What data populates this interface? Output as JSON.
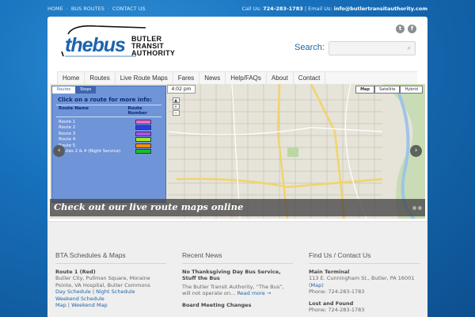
{
  "topbar": {
    "nav": [
      "HOME",
      "BUS ROUTES",
      "CONTACT US"
    ],
    "call_label": "Call Us:",
    "phone": "724-283-1783",
    "email_label": "Email Us:",
    "email": "info@butlertransitauthority.com"
  },
  "header": {
    "logo_word": "thebus",
    "logo_lines": [
      "BUTLER",
      "TRANSIT",
      "AUTHORITY"
    ],
    "search_label": "Search:",
    "search_placeholder": "",
    "social": [
      "t",
      "f"
    ]
  },
  "nav": [
    "Home",
    "Routes",
    "Live Route Maps",
    "Fares",
    "News",
    "Help/FAQs",
    "About",
    "Contact"
  ],
  "slider": {
    "tabs": [
      "Routes",
      "Stops"
    ],
    "title": "Click on a route for more info:",
    "col_route": "Route Name",
    "col_number": "Route Number",
    "routes": [
      {
        "name": "Route 1",
        "color": "#ff66cc"
      },
      {
        "name": "Route 2",
        "color": "#2a3ee0"
      },
      {
        "name": "Route 3",
        "color": "#b24ef0"
      },
      {
        "name": "Route 4",
        "color": "#a0e830"
      },
      {
        "name": "Route 5",
        "color": "#ff8c00"
      },
      {
        "name": "Routes 2 & 4 (Night Service)",
        "color": "#22bb22"
      }
    ],
    "time": "4:02 pm",
    "map_types": [
      "Map",
      "Satellite",
      "Hybrid"
    ],
    "caption": "Check out our live route maps online",
    "prev_icon": "chevron-left-icon",
    "next_icon": "chevron-right-icon"
  },
  "columns": {
    "schedules": {
      "heading": "BTA Schedules & Maps",
      "route_title": "Route 1 (Red)",
      "route_desc": "Butler City, Pullman Square, Moraine Pointe, VA Hospital, Butler Commons",
      "day_schedule": "Day Schedule",
      "sep1": "|",
      "night_schedule": "Night Schedule",
      "weekend_schedule": "Weekend Schedule",
      "map": "Map",
      "sep2": "|",
      "weekend_map": "Weekend Map"
    },
    "news": {
      "heading": "Recent News",
      "post1_title": "No Thanksgiving Day Bus Service, Stuff the Bus",
      "post1_excerpt": "The Butler Transit Authority, “The Bus”, will not operate on…",
      "read_more": "Read more →",
      "post2_title": "Board Meeting Changes"
    },
    "contact": {
      "heading": "Find Us / Contact Us",
      "office_title": "Main Terminal",
      "address": "113 E. Cunningham St., Butler, PA 16001 (",
      "map_link": "Map",
      "address_end": ")",
      "phone1": "Phone: 724-283-1783",
      "lost_title": "Lost and Found",
      "phone2": "Phone: 724-283-1783"
    }
  }
}
